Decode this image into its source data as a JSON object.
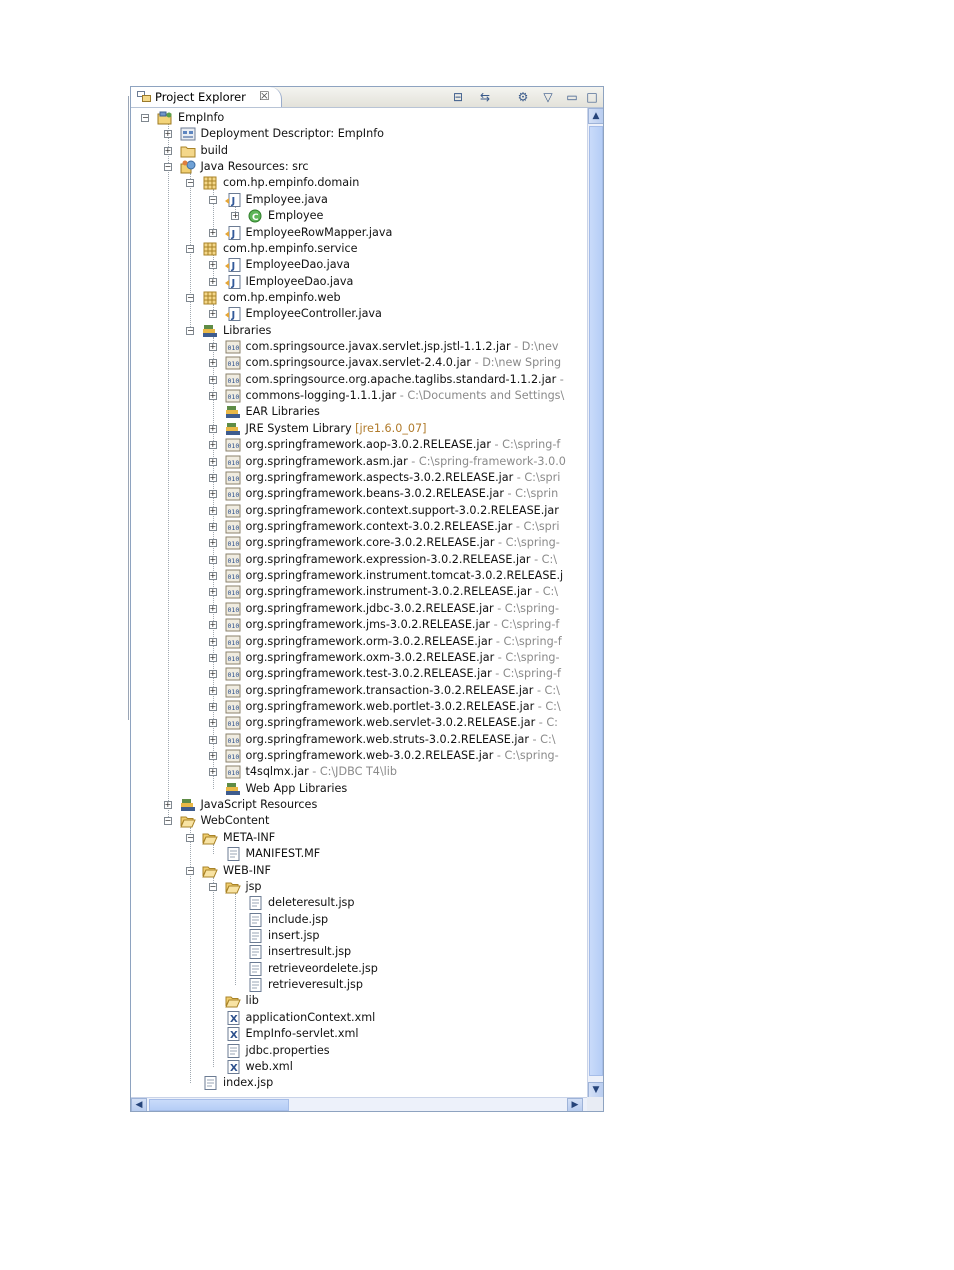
{
  "view": {
    "title": "Project Explorer",
    "close_glyph": "☒",
    "toolbar": [
      {
        "name": "collapse-all-icon",
        "glyph": "⊟"
      },
      {
        "name": "link-with-editor-icon",
        "glyph": "⇆"
      },
      {
        "name": "filters-icon",
        "glyph": "⚙"
      },
      {
        "name": "view-menu-icon",
        "glyph": "▽"
      },
      {
        "name": "minimize-icon",
        "glyph": "▭"
      },
      {
        "name": "maximize-icon",
        "glyph": "□"
      }
    ]
  },
  "colors": {
    "accent": "#3a6ea5",
    "decoration": "#8a8a8a",
    "jre_decoration": "#b07a2a",
    "scroll": "#b5cdf6"
  },
  "tree": [
    {
      "d": 0,
      "t": "-",
      "icon": "project",
      "label": "EmpInfo"
    },
    {
      "d": 1,
      "t": "+",
      "icon": "descriptor",
      "label": "Deployment Descriptor: EmpInfo"
    },
    {
      "d": 1,
      "t": "+",
      "icon": "folder",
      "label": "build"
    },
    {
      "d": 1,
      "t": "-",
      "icon": "java-resources",
      "label": "Java Resources: src"
    },
    {
      "d": 2,
      "t": "-",
      "icon": "package",
      "label": "com.hp.empinfo.domain"
    },
    {
      "d": 3,
      "t": "-",
      "icon": "java-file",
      "label": "Employee.java"
    },
    {
      "d": 4,
      "t": "+",
      "icon": "class",
      "label": "Employee"
    },
    {
      "d": 3,
      "t": "+",
      "icon": "java-file",
      "label": "EmployeeRowMapper.java"
    },
    {
      "d": 2,
      "t": "-",
      "icon": "package",
      "label": "com.hp.empinfo.service"
    },
    {
      "d": 3,
      "t": "+",
      "icon": "java-file",
      "label": "EmployeeDao.java"
    },
    {
      "d": 3,
      "t": "+",
      "icon": "java-file",
      "label": "IEmployeeDao.java"
    },
    {
      "d": 2,
      "t": "-",
      "icon": "package",
      "label": "com.hp.empinfo.web"
    },
    {
      "d": 3,
      "t": "+",
      "icon": "java-file",
      "label": "EmployeeController.java"
    },
    {
      "d": 2,
      "t": "-",
      "icon": "library",
      "label": "Libraries"
    },
    {
      "d": 3,
      "t": "+",
      "icon": "jar",
      "label": "com.springsource.javax.servlet.jsp.jstl-1.1.2.jar",
      "dec": " - D:\\nev"
    },
    {
      "d": 3,
      "t": "+",
      "icon": "jar",
      "label": "com.springsource.javax.servlet-2.4.0.jar",
      "dec": " - D:\\new Spring"
    },
    {
      "d": 3,
      "t": "+",
      "icon": "jar",
      "label": "com.springsource.org.apache.taglibs.standard-1.1.2.jar",
      "dec": " -"
    },
    {
      "d": 3,
      "t": "+",
      "icon": "jar",
      "label": "commons-logging-1.1.1.jar",
      "dec": " - C:\\Documents and Settings\\"
    },
    {
      "d": 3,
      "t": "",
      "icon": "library",
      "label": "EAR Libraries"
    },
    {
      "d": 3,
      "t": "+",
      "icon": "library",
      "label": "JRE System Library",
      "dec2": " [jre1.6.0_07]"
    },
    {
      "d": 3,
      "t": "+",
      "icon": "jar",
      "label": "org.springframework.aop-3.0.2.RELEASE.jar",
      "dec": " - C:\\spring-f"
    },
    {
      "d": 3,
      "t": "+",
      "icon": "jar",
      "label": "org.springframework.asm.jar",
      "dec": " - C:\\spring-framework-3.0.0"
    },
    {
      "d": 3,
      "t": "+",
      "icon": "jar",
      "label": "org.springframework.aspects-3.0.2.RELEASE.jar",
      "dec": " - C:\\spri"
    },
    {
      "d": 3,
      "t": "+",
      "icon": "jar",
      "label": "org.springframework.beans-3.0.2.RELEASE.jar",
      "dec": " - C:\\sprin"
    },
    {
      "d": 3,
      "t": "+",
      "icon": "jar",
      "label": "org.springframework.context.support-3.0.2.RELEASE.jar"
    },
    {
      "d": 3,
      "t": "+",
      "icon": "jar",
      "label": "org.springframework.context-3.0.2.RELEASE.jar",
      "dec": " - C:\\spri"
    },
    {
      "d": 3,
      "t": "+",
      "icon": "jar",
      "label": "org.springframework.core-3.0.2.RELEASE.jar",
      "dec": " - C:\\spring-"
    },
    {
      "d": 3,
      "t": "+",
      "icon": "jar",
      "label": "org.springframework.expression-3.0.2.RELEASE.jar",
      "dec": " - C:\\"
    },
    {
      "d": 3,
      "t": "+",
      "icon": "jar",
      "label": "org.springframework.instrument.tomcat-3.0.2.RELEASE.j"
    },
    {
      "d": 3,
      "t": "+",
      "icon": "jar",
      "label": "org.springframework.instrument-3.0.2.RELEASE.jar",
      "dec": " - C:\\"
    },
    {
      "d": 3,
      "t": "+",
      "icon": "jar",
      "label": "org.springframework.jdbc-3.0.2.RELEASE.jar",
      "dec": " - C:\\spring-"
    },
    {
      "d": 3,
      "t": "+",
      "icon": "jar",
      "label": "org.springframework.jms-3.0.2.RELEASE.jar",
      "dec": " - C:\\spring-f"
    },
    {
      "d": 3,
      "t": "+",
      "icon": "jar",
      "label": "org.springframework.orm-3.0.2.RELEASE.jar",
      "dec": " - C:\\spring-f"
    },
    {
      "d": 3,
      "t": "+",
      "icon": "jar",
      "label": "org.springframework.oxm-3.0.2.RELEASE.jar",
      "dec": " - C:\\spring-"
    },
    {
      "d": 3,
      "t": "+",
      "icon": "jar",
      "label": "org.springframework.test-3.0.2.RELEASE.jar",
      "dec": " - C:\\spring-f"
    },
    {
      "d": 3,
      "t": "+",
      "icon": "jar",
      "label": "org.springframework.transaction-3.0.2.RELEASE.jar",
      "dec": " - C:\\"
    },
    {
      "d": 3,
      "t": "+",
      "icon": "jar",
      "label": "org.springframework.web.portlet-3.0.2.RELEASE.jar",
      "dec": " - C:\\"
    },
    {
      "d": 3,
      "t": "+",
      "icon": "jar",
      "label": "org.springframework.web.servlet-3.0.2.RELEASE.jar",
      "dec": " - C:"
    },
    {
      "d": 3,
      "t": "+",
      "icon": "jar",
      "label": "org.springframework.web.struts-3.0.2.RELEASE.jar",
      "dec": " - C:\\"
    },
    {
      "d": 3,
      "t": "+",
      "icon": "jar",
      "label": "org.springframework.web-3.0.2.RELEASE.jar",
      "dec": " - C:\\spring-"
    },
    {
      "d": 3,
      "t": "+",
      "icon": "jar",
      "label": "t4sqlmx.jar",
      "dec": " - C:\\JDBC T4\\lib"
    },
    {
      "d": 3,
      "t": "",
      "icon": "library",
      "label": "Web App Libraries"
    },
    {
      "d": 1,
      "t": "+",
      "icon": "library",
      "label": "JavaScript Resources"
    },
    {
      "d": 1,
      "t": "-",
      "icon": "folder-open",
      "label": "WebContent"
    },
    {
      "d": 2,
      "t": "-",
      "icon": "folder-open",
      "label": "META-INF"
    },
    {
      "d": 3,
      "t": "",
      "icon": "file",
      "label": "MANIFEST.MF"
    },
    {
      "d": 2,
      "t": "-",
      "icon": "folder-open",
      "label": "WEB-INF"
    },
    {
      "d": 3,
      "t": "-",
      "icon": "folder-open",
      "label": "jsp"
    },
    {
      "d": 4,
      "t": "",
      "icon": "file",
      "label": "deleteresult.jsp"
    },
    {
      "d": 4,
      "t": "",
      "icon": "file",
      "label": "include.jsp"
    },
    {
      "d": 4,
      "t": "",
      "icon": "file",
      "label": "insert.jsp"
    },
    {
      "d": 4,
      "t": "",
      "icon": "file",
      "label": "insertresult.jsp"
    },
    {
      "d": 4,
      "t": "",
      "icon": "file",
      "label": "retrieveordelete.jsp"
    },
    {
      "d": 4,
      "t": "",
      "icon": "file",
      "label": "retrieveresult.jsp"
    },
    {
      "d": 3,
      "t": "",
      "icon": "folder-open",
      "label": "lib"
    },
    {
      "d": 3,
      "t": "",
      "icon": "xml",
      "label": "applicationContext.xml"
    },
    {
      "d": 3,
      "t": "",
      "icon": "xml",
      "label": "EmpInfo-servlet.xml"
    },
    {
      "d": 3,
      "t": "",
      "icon": "file",
      "label": "jdbc.properties"
    },
    {
      "d": 3,
      "t": "",
      "icon": "xml",
      "label": "web.xml"
    },
    {
      "d": 2,
      "t": "",
      "icon": "file",
      "label": "index.jsp"
    }
  ],
  "scrollbars": {
    "up": "▲",
    "down": "▼",
    "left": "◀",
    "right": "▶"
  }
}
